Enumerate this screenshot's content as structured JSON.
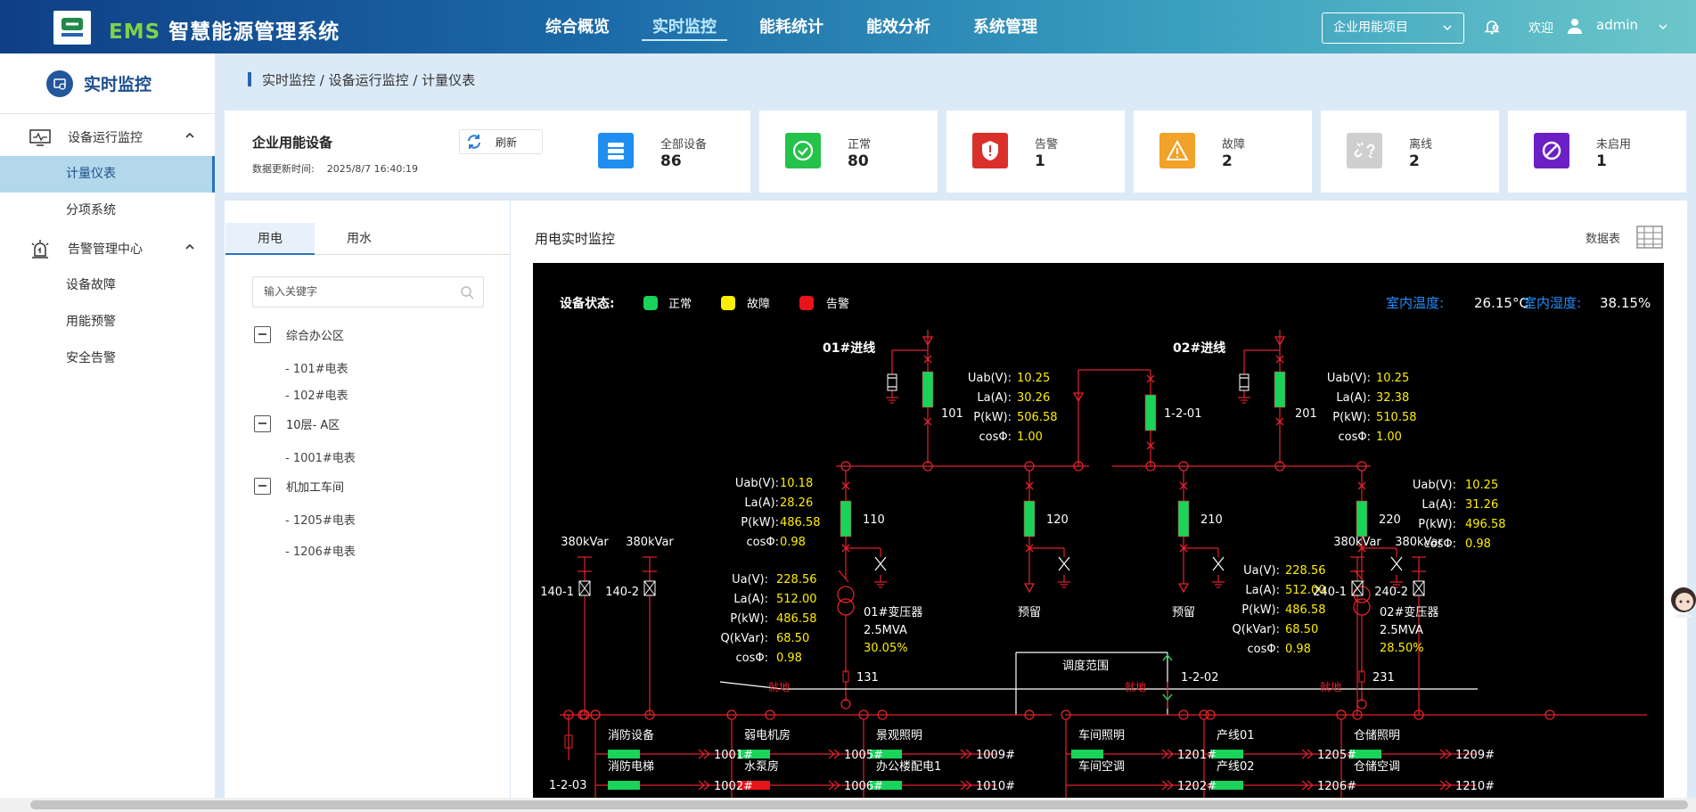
{
  "header": {
    "app_title_prefix": "EMS",
    "app_title": "智慧能源管理系统",
    "nav": [
      "综合概览",
      "实时监控",
      "能耗统计",
      "能效分析",
      "系统管理"
    ],
    "active_nav": "实时监控",
    "project_select": "企业用能项目",
    "welcome": "欢迎",
    "user": "admin"
  },
  "sidebar": {
    "title": "实时监控",
    "groups": [
      {
        "label": "设备运行监控",
        "items": [
          "计量仪表",
          "分项系统"
        ]
      },
      {
        "label": "告警管理中心",
        "items": [
          "设备故障",
          "用能预警",
          "安全告警"
        ]
      }
    ],
    "active_item": "计量仪表"
  },
  "breadcrumb": "实时监控 / 设备运行监控 / 计量仪表",
  "summary": {
    "title": "企业用能设备",
    "update_label": "数据更新时间:",
    "update_time": "2025/8/7 16:40:19",
    "refresh": "刷新"
  },
  "stats": [
    {
      "label": "全部设备",
      "value": "86",
      "color": "#1f8ef0",
      "icon": "server-icon"
    },
    {
      "label": "正常",
      "value": "80",
      "color": "#25c24a",
      "icon": "check-icon"
    },
    {
      "label": "告警",
      "value": "1",
      "color": "#d9302b",
      "icon": "shield-alert-icon"
    },
    {
      "label": "故障",
      "value": "2",
      "color": "#f0a229",
      "icon": "warning-icon"
    },
    {
      "label": "离线",
      "value": "2",
      "color": "#cfcfcf",
      "icon": "broken-link-icon"
    },
    {
      "label": "未启用",
      "value": "1",
      "color": "#6b1fc4",
      "icon": "disabled-icon"
    }
  ],
  "tree": {
    "tabs": [
      "用电",
      "用水"
    ],
    "active_tab": "用电",
    "search_placeholder": "输入关键字",
    "nodes": [
      {
        "label": "综合办公区",
        "children": [
          "101#电表",
          "102#电表"
        ]
      },
      {
        "label": "10层- A区",
        "children": [
          "1001#电表"
        ]
      },
      {
        "label": "机加工车间",
        "children": [
          "1205#电表",
          "1206#电表"
        ]
      }
    ]
  },
  "monitor": {
    "title": "用电实时监控",
    "datatable": "数据表",
    "status_label": "设备状态:",
    "legend": [
      {
        "label": "正常",
        "color": "#19d35a"
      },
      {
        "label": "故障",
        "color": "#ffee00"
      },
      {
        "label": "告警",
        "color": "#e8141a"
      }
    ],
    "temp_label": "室内温度:",
    "temp_value": "26.15°C",
    "humid_label": "室内湿度:",
    "humid_value": "38.15%",
    "incoming": [
      "01#进线",
      "02#进线"
    ],
    "meter_labels": [
      "Uab(V):",
      "La(A):",
      "P(kW):",
      "cosΦ:"
    ],
    "tx_labels": [
      "Ua(V):",
      "La(A):",
      "P(kW):",
      "Q(kVar):",
      "cosΦ:"
    ],
    "in1_values": [
      "10.25",
      "30.26",
      "506.58",
      "1.00"
    ],
    "in2_values": [
      "10.25",
      "32.38",
      "510.58",
      "1.00"
    ],
    "f110_values": [
      "10.18",
      "28.26",
      "486.58",
      "0.98"
    ],
    "f220_values": [
      "10.25",
      "31.26",
      "496.58",
      "0.98"
    ],
    "tx1_values": [
      "228.56",
      "512.00",
      "486.58",
      "68.50",
      "0.98"
    ],
    "tx2_values": [
      "228.56",
      "512.00",
      "486.58",
      "68.50",
      "0.98"
    ],
    "breakers": [
      "101",
      "1-2-01",
      "201",
      "110",
      "120",
      "210",
      "220",
      "131",
      "1-2-02",
      "231",
      "1-2-03"
    ],
    "reserve": "预留",
    "tx1": [
      "01#变压器",
      "2.5MVA",
      "30.05%"
    ],
    "tx2": [
      "02#变压器",
      "2.5MVA",
      "28.50%"
    ],
    "dispatch": "调度范围",
    "local": "就地",
    "caps": [
      "380kVar",
      "380kVar",
      "380kVar",
      "380kVar"
    ],
    "cap_ids": [
      "140-1",
      "140-2",
      "240-1",
      "240-2"
    ],
    "loads": [
      {
        "name": "消防设备",
        "id": "1001#",
        "state": "normal"
      },
      {
        "name": "消防电梯",
        "id": "1002#",
        "state": "normal"
      },
      {
        "name": "弱电机房",
        "id": "1005#",
        "state": "normal"
      },
      {
        "name": "水泵房",
        "id": "1006#",
        "state": "alarm"
      },
      {
        "name": "景观照明",
        "id": "1009#",
        "state": "normal"
      },
      {
        "name": "办公楼配电1",
        "id": "1010#",
        "state": "normal"
      },
      {
        "name": "车间照明",
        "id": "1201#",
        "state": "normal"
      },
      {
        "name": "车间空调",
        "id": "1202#",
        "state": "none"
      },
      {
        "name": "产线01",
        "id": "1205#",
        "state": "normal"
      },
      {
        "name": "产线02",
        "id": "1206#",
        "state": "normal"
      },
      {
        "name": "仓储照明",
        "id": "1209#",
        "state": "normal"
      },
      {
        "name": "仓储空调",
        "id": "1210#",
        "state": "none"
      }
    ]
  }
}
